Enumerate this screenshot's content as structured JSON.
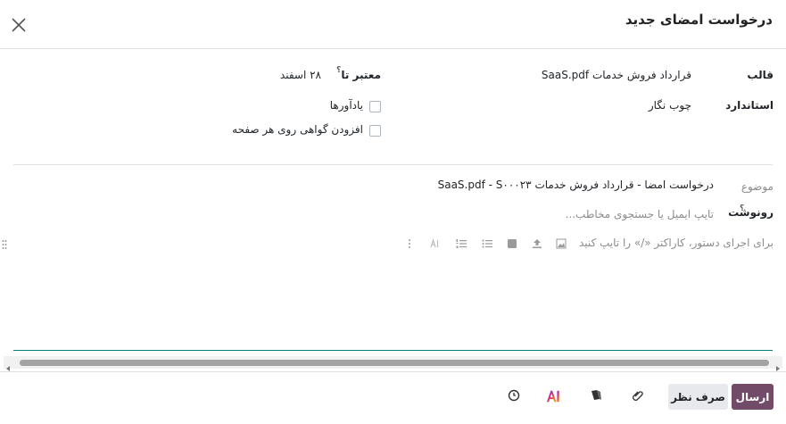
{
  "dialog": {
    "title": "درخواست امضای جدید"
  },
  "form": {
    "template_label": "قالب",
    "template_value": "قرارداد فروش خدمات SaaS.pdf",
    "valid_until_label": "معتبر تا",
    "valid_until_help": "؟",
    "valid_until_value": "۲۸ اسفند",
    "signer_label": "استاندارد",
    "signer_value": "چوب نگار",
    "reminders_label": "یادآورها",
    "certificate_label": "افزودن گواهی روی هر صفحه",
    "subject_label": "موضوع",
    "subject_value": "درخواست امضا - قرارداد فروش خدمات SaaS.pdf - S۰۰۰۲۳",
    "cc_label": "رونوشت",
    "cc_help": "؟",
    "cc_placeholder": "تایپ ایمیل یا جستجوی مخاطب...",
    "editor_placeholder": "برای اجرای دستور، کاراکتر «/» را تایپ کنید"
  },
  "toolbar": {
    "icons": [
      "image-icon",
      "upload-icon",
      "square-icon",
      "bulleted-list-icon",
      "numbered-list-icon",
      "ai-icon",
      "more-vertical-icon"
    ]
  },
  "footer": {
    "send_label": "ارسال",
    "cancel_label": "صرف نظر"
  },
  "colors": {
    "primary": "#714b67",
    "secondary_button": "#e7e9ed",
    "editor_border": "#017e84"
  }
}
